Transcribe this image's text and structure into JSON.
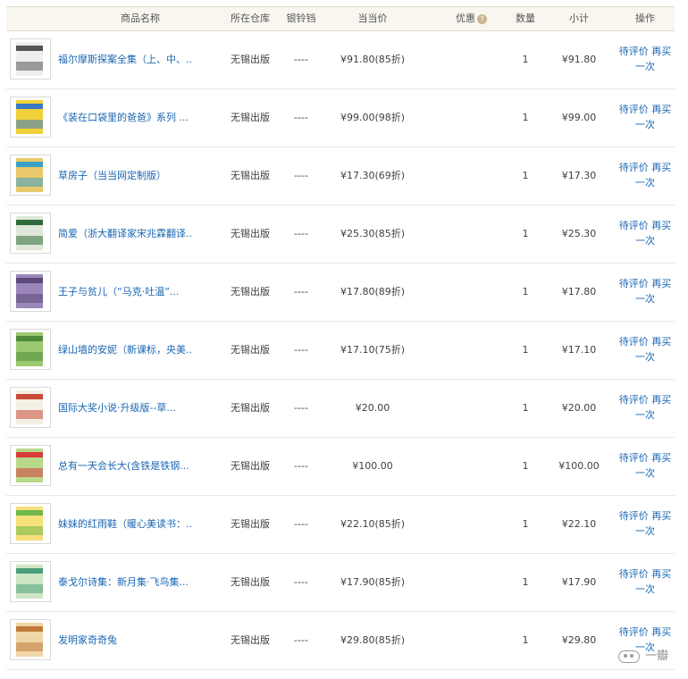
{
  "header": {
    "name": "商品名称",
    "warehouse": "所在仓库",
    "silver_bell": "银铃铛",
    "price": "当当价",
    "promo": "优惠",
    "promo_icon": "?",
    "qty": "数量",
    "subtotal": "小计",
    "ops": "操作"
  },
  "rows": [
    {
      "title": "福尔摩斯探案全集（上、中、...",
      "warehouse": "无锡出版",
      "bell": "----",
      "price": "¥91.80(85折)",
      "qty": "1",
      "subtotal": "¥91.80",
      "review": "待评价",
      "rebuy": "再买一次",
      "cover_color": "#eeeeee",
      "stripe_color": "#555555"
    },
    {
      "title": "《装在口袋里的爸爸》系列 ...",
      "warehouse": "无锡出版",
      "bell": "----",
      "price": "¥99.00(98折)",
      "qty": "1",
      "subtotal": "¥99.00",
      "review": "待评价",
      "rebuy": "再买一次",
      "cover_color": "#f2d23a",
      "stripe_color": "#3a78c2"
    },
    {
      "title": "草房子（当当网定制版）",
      "warehouse": "无锡出版",
      "bell": "----",
      "price": "¥17.30(69折)",
      "qty": "1",
      "subtotal": "¥17.30",
      "review": "待评价",
      "rebuy": "再买一次",
      "cover_color": "#e9c96a",
      "stripe_color": "#3aa0c8"
    },
    {
      "title": "简爱（浙大翻译家宋兆霖翻译...",
      "warehouse": "无锡出版",
      "bell": "----",
      "price": "¥25.30(85折)",
      "qty": "1",
      "subtotal": "¥25.30",
      "review": "待评价",
      "rebuy": "再买一次",
      "cover_color": "#dfe8d8",
      "stripe_color": "#2f6b3a"
    },
    {
      "title": "王子与贫儿（“马克·吐温”...",
      "warehouse": "无锡出版",
      "bell": "----",
      "price": "¥17.80(89折)",
      "qty": "1",
      "subtotal": "¥17.80",
      "review": "待评价",
      "rebuy": "再买一次",
      "cover_color": "#9a86b8",
      "stripe_color": "#5b4a7a"
    },
    {
      "title": "绿山墙的安妮（新课标，央美...",
      "warehouse": "无锡出版",
      "bell": "----",
      "price": "¥17.10(75折)",
      "qty": "1",
      "subtotal": "¥17.10",
      "review": "待评价",
      "rebuy": "再买一次",
      "cover_color": "#9cc870",
      "stripe_color": "#4e8a3a"
    },
    {
      "title": "国际大奖小说·升级版--草...",
      "warehouse": "无锡出版",
      "bell": "----",
      "price": "¥20.00",
      "qty": "1",
      "subtotal": "¥20.00",
      "review": "待评价",
      "rebuy": "再买一次",
      "cover_color": "#f4efe4",
      "stripe_color": "#c84a3a"
    },
    {
      "title": "总有一天会长大(含铁是铁钢...",
      "warehouse": "无锡出版",
      "bell": "----",
      "price": "¥100.00",
      "qty": "1",
      "subtotal": "¥100.00",
      "review": "待评价",
      "rebuy": "再买一次",
      "cover_color": "#b8d88a",
      "stripe_color": "#d83a3a"
    },
    {
      "title": "妹妹的红雨鞋（暖心美读书：...",
      "warehouse": "无锡出版",
      "bell": "----",
      "price": "¥22.10(85折)",
      "qty": "1",
      "subtotal": "¥22.10",
      "review": "待评价",
      "rebuy": "再买一次",
      "cover_color": "#f6e07a",
      "stripe_color": "#6fb84a"
    },
    {
      "title": "泰戈尔诗集：新月集·飞鸟集...",
      "warehouse": "无锡出版",
      "bell": "----",
      "price": "¥17.90(85折)",
      "qty": "1",
      "subtotal": "¥17.90",
      "review": "待评价",
      "rebuy": "再买一次",
      "cover_color": "#cfe6c4",
      "stripe_color": "#4aa07a"
    },
    {
      "title": "发明家奇奇兔",
      "warehouse": "无锡出版",
      "bell": "----",
      "price": "¥29.80(85折)",
      "qty": "1",
      "subtotal": "¥29.80",
      "review": "待评价",
      "rebuy": "再买一次",
      "cover_color": "#f0d6a8",
      "stripe_color": "#c07a3a"
    }
  ],
  "watermark": {
    "text": "一瓣",
    "icon": "wechat-icon"
  }
}
